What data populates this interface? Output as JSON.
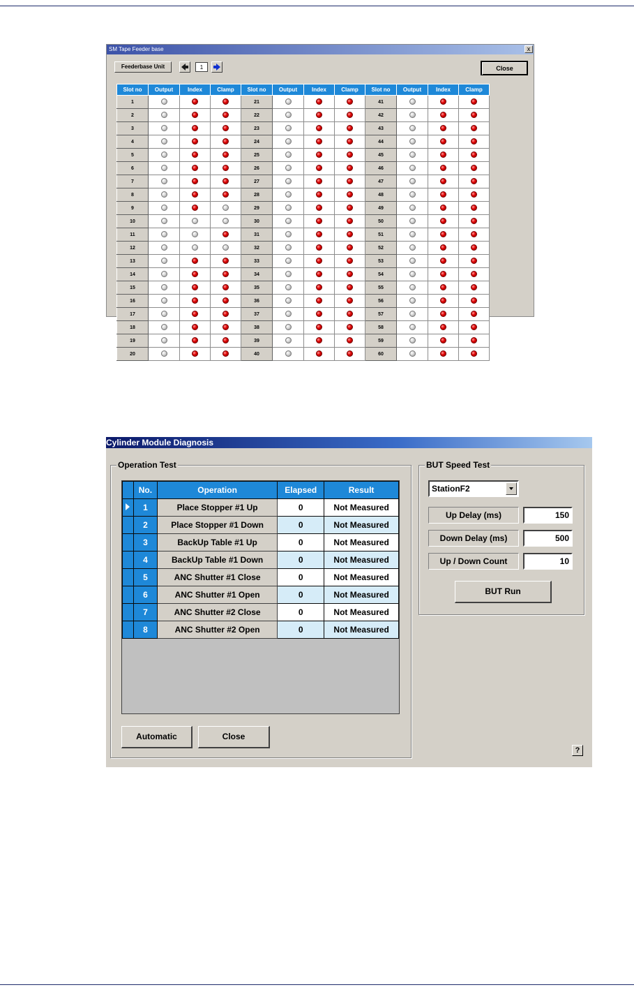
{
  "window1": {
    "title": "SM Tape Feeder base",
    "close_x": "x",
    "unit_label": "Feederbase Unit",
    "unit_number": "1",
    "close_label": "Close",
    "headers": [
      "Slot no",
      "Output",
      "Index",
      "Clamp",
      "Slot no",
      "Output",
      "Index",
      "Clamp",
      "Slot no",
      "Output",
      "Index",
      "Clamp"
    ],
    "slots": [
      "1",
      "2",
      "3",
      "4",
      "5",
      "6",
      "7",
      "8",
      "9",
      "10",
      "11",
      "12",
      "13",
      "14",
      "15",
      "16",
      "17",
      "18",
      "19",
      "20",
      "21",
      "22",
      "23",
      "24",
      "25",
      "26",
      "27",
      "28",
      "29",
      "30",
      "31",
      "32",
      "33",
      "34",
      "35",
      "36",
      "37",
      "38",
      "39",
      "40",
      "41",
      "42",
      "43",
      "44",
      "45",
      "46",
      "47",
      "48",
      "49",
      "50",
      "51",
      "52",
      "53",
      "54",
      "55",
      "56",
      "57",
      "58",
      "59",
      "60"
    ],
    "states": [
      "011",
      "011",
      "011",
      "011",
      "011",
      "011",
      "011",
      "011",
      "010",
      "000",
      "001",
      "000",
      "011",
      "011",
      "011",
      "011",
      "011",
      "011",
      "011",
      "011",
      "011",
      "011",
      "011",
      "011",
      "011",
      "011",
      "011",
      "011",
      "011",
      "011",
      "011",
      "011",
      "011",
      "011",
      "011",
      "011",
      "011",
      "011",
      "011",
      "011",
      "011",
      "011",
      "011",
      "011",
      "011",
      "011",
      "011",
      "011",
      "011",
      "011",
      "011",
      "011",
      "011",
      "011",
      "011",
      "011",
      "011",
      "011",
      "011",
      "011"
    ],
    "colors": {
      "header_bg": "#1e88d8",
      "led_on": "#e00000",
      "led_off": "#c8c8c8"
    }
  },
  "window2": {
    "title": "Cylinder Module Diagnosis",
    "operation_test_label": "Operation Test",
    "headers": {
      "no": "No.",
      "operation": "Operation",
      "elapsed": "Elapsed",
      "result": "Result"
    },
    "rows": [
      {
        "no": "1",
        "operation": "Place Stopper #1 Up",
        "elapsed": "0",
        "result": "Not Measured"
      },
      {
        "no": "2",
        "operation": "Place Stopper #1 Down",
        "elapsed": "0",
        "result": "Not Measured"
      },
      {
        "no": "3",
        "operation": "BackUp Table #1 Up",
        "elapsed": "0",
        "result": "Not Measured"
      },
      {
        "no": "4",
        "operation": "BackUp Table #1 Down",
        "elapsed": "0",
        "result": "Not Measured"
      },
      {
        "no": "5",
        "operation": "ANC Shutter #1 Close",
        "elapsed": "0",
        "result": "Not Measured"
      },
      {
        "no": "6",
        "operation": "ANC Shutter #1 Open",
        "elapsed": "0",
        "result": "Not Measured"
      },
      {
        "no": "7",
        "operation": "ANC Shutter #2 Close",
        "elapsed": "0",
        "result": "Not Measured"
      },
      {
        "no": "8",
        "operation": "ANC Shutter #2 Open",
        "elapsed": "0",
        "result": "Not Measured"
      }
    ],
    "automatic_label": "Automatic",
    "close_label": "Close",
    "but_label": "BUT Speed Test",
    "station": "StationF2",
    "up_delay_label": "Up Delay (ms)",
    "up_delay_value": "150",
    "down_delay_label": "Down Delay (ms)",
    "down_delay_value": "500",
    "count_label": "Up / Down Count",
    "count_value": "10",
    "run_label": "BUT Run",
    "help_label": "?"
  }
}
